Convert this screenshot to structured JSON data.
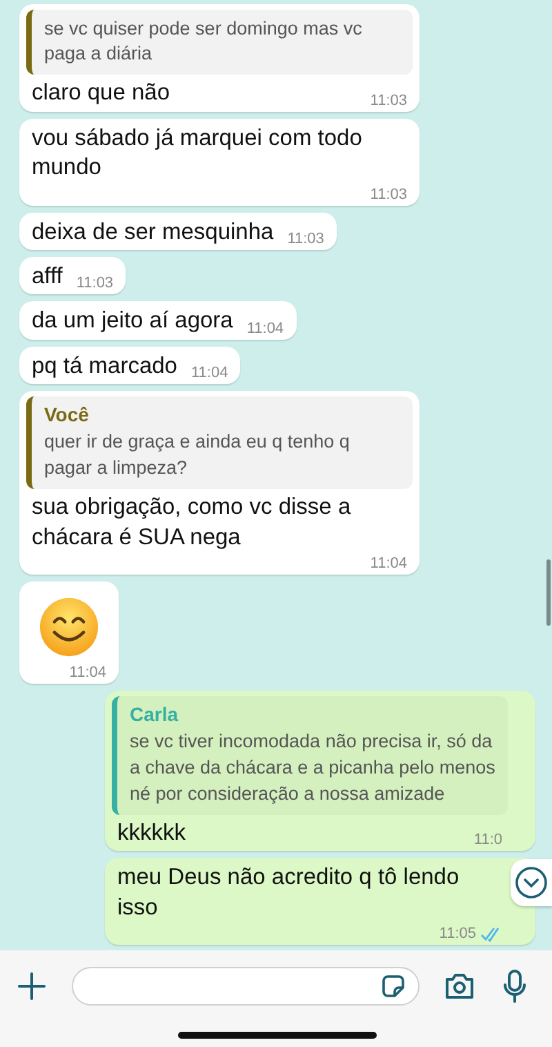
{
  "messages": [
    {
      "kind": "text",
      "outgoing": false,
      "quote": {
        "text": "se vc quiser pode ser domingo mas vc paga a diária",
        "color": "#7a6a14"
      },
      "text": "claro que não",
      "time": "11:03"
    },
    {
      "kind": "text",
      "outgoing": false,
      "text": "vou sábado já marquei com todo mundo",
      "time": "11:03"
    },
    {
      "kind": "text",
      "outgoing": false,
      "text": "deixa de ser mesquinha",
      "time": "11:03"
    },
    {
      "kind": "text",
      "outgoing": false,
      "text": "afff",
      "time": "11:03"
    },
    {
      "kind": "text",
      "outgoing": false,
      "text": "da um jeito aí agora",
      "time": "11:04"
    },
    {
      "kind": "text",
      "outgoing": false,
      "text": "pq tá marcado",
      "time": "11:04"
    },
    {
      "kind": "text",
      "outgoing": false,
      "quote": {
        "author": "Você",
        "text": "quer ir de graça e ainda eu q tenho q pagar a limpeza?",
        "color": "#7a6a14"
      },
      "text": "sua obrigação, como vc disse a chácara é SUA nega",
      "time": "11:04"
    },
    {
      "kind": "emoji",
      "outgoing": false,
      "time": "11:04"
    },
    {
      "kind": "text",
      "outgoing": true,
      "quote": {
        "author": "Carla",
        "text": "se vc tiver incomodada não precisa ir, só da a chave da chácara e a picanha pelo menos né por consideração a nossa amizade",
        "color": "#35b0a3"
      },
      "text": "kkkkkk",
      "time": "11:0"
    },
    {
      "kind": "text",
      "outgoing": true,
      "text": "meu Deus não acredito q tô lendo isso",
      "time": "11:05",
      "read": true
    }
  ]
}
